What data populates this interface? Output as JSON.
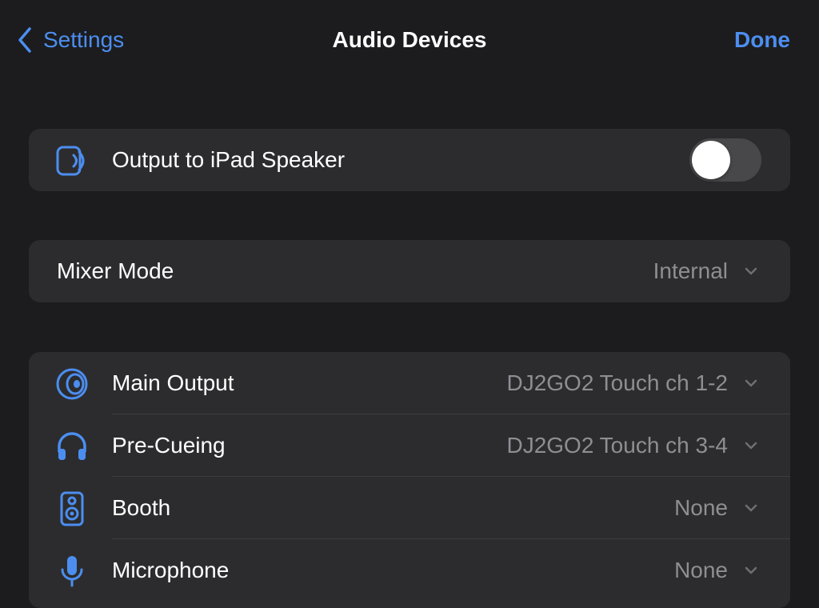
{
  "nav": {
    "back_label": "Settings",
    "title": "Audio Devices",
    "done_label": "Done"
  },
  "speaker": {
    "label": "Output to iPad Speaker",
    "icon": "ipad-speaker-icon",
    "toggle_on": false
  },
  "mixer": {
    "label": "Mixer Mode",
    "value": "Internal"
  },
  "routing": [
    {
      "icon": "speaker-cone-icon",
      "label": "Main Output",
      "value": "DJ2GO2 Touch ch 1-2"
    },
    {
      "icon": "headphones-icon",
      "label": "Pre-Cueing",
      "value": "DJ2GO2 Touch ch 3-4"
    },
    {
      "icon": "booth-speaker-icon",
      "label": "Booth",
      "value": "None"
    },
    {
      "icon": "microphone-icon",
      "label": "Microphone",
      "value": "None"
    }
  ],
  "colors": {
    "accent": "#4c8ef0",
    "background": "#1c1c1e",
    "cell": "#2c2c2e",
    "secondary_text": "#8e8e93"
  }
}
